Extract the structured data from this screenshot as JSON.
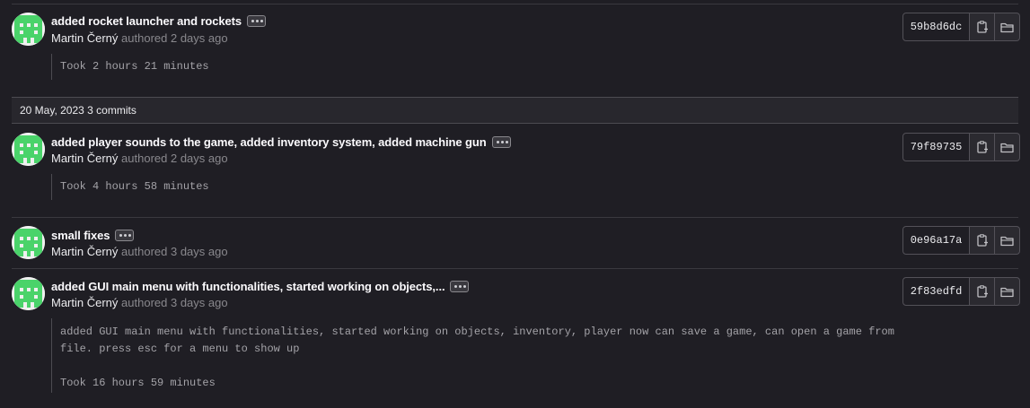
{
  "day_header": {
    "date": "20 May, 2023",
    "count": "3 commits"
  },
  "commits": [
    {
      "title": "added rocket launcher and rockets",
      "author": "Martin Černý",
      "meta": "authored 2 days ago",
      "description": "Took 2 hours 21 minutes",
      "sha": "59b8d6dc"
    },
    {
      "title": "added player sounds to the game, added inventory system, added machine gun",
      "author": "Martin Černý",
      "meta": "authored 2 days ago",
      "description": "Took 4 hours 58 minutes",
      "sha": "79f89735"
    },
    {
      "title": "small fixes",
      "author": "Martin Černý",
      "meta": "authored 3 days ago",
      "description": "",
      "sha": "0e96a17a"
    },
    {
      "title": "added GUI main menu with functionalities, started working on objects,...",
      "author": "Martin Černý",
      "meta": "authored 3 days ago",
      "description": "added GUI main menu with functionalities, started working on objects, inventory, player now can save a game, can open a game from\nfile. press esc for a menu to show up\n\nTook 16 hours 59 minutes",
      "sha": "2f83edfd"
    }
  ],
  "icons": {
    "copy": "copy-icon",
    "browse": "folder-icon",
    "options": "ellipsis-icon"
  },
  "colors": {
    "background": "#1f1e24",
    "avatar_green": "#4ad36a",
    "border": "#535158"
  }
}
